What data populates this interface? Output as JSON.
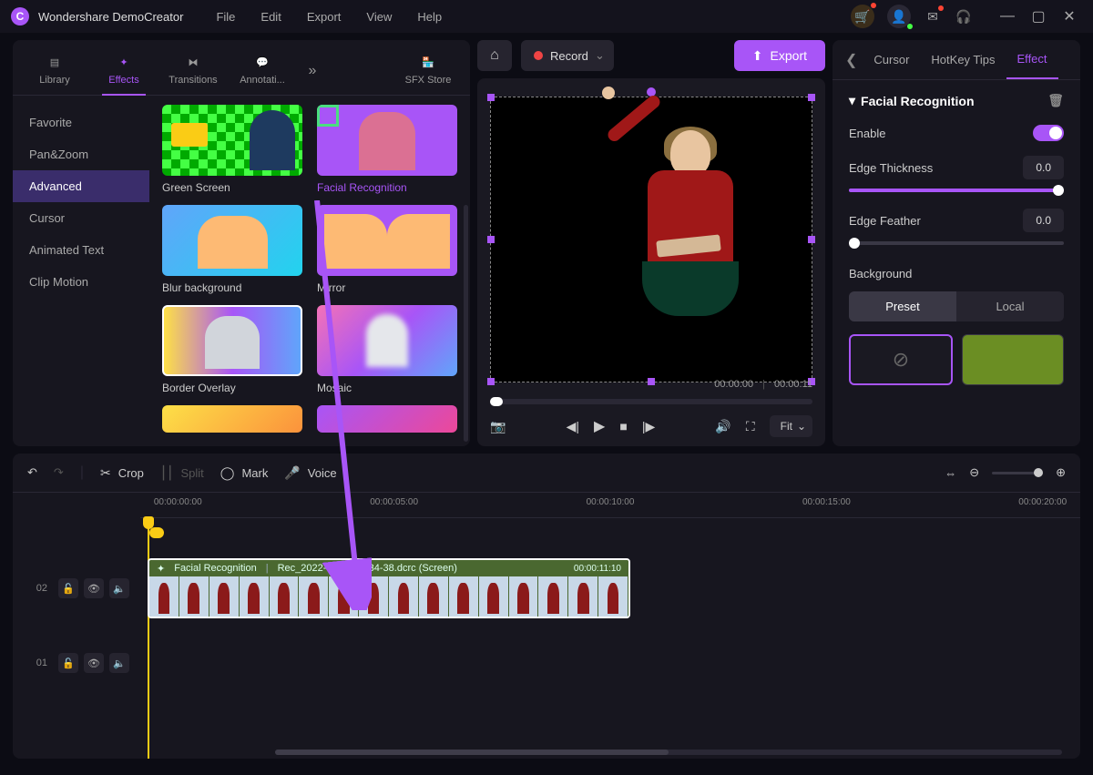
{
  "app": {
    "title": "Wondershare DemoCreator"
  },
  "menu": {
    "file": "File",
    "edit": "Edit",
    "export": "Export",
    "view": "View",
    "help": "Help"
  },
  "tabs": {
    "library": "Library",
    "effects": "Effects",
    "transitions": "Transitions",
    "annotations": "Annotati...",
    "sfx": "SFX Store"
  },
  "sidebar": {
    "favorite": "Favorite",
    "panzoom": "Pan&Zoom",
    "advanced": "Advanced",
    "cursor": "Cursor",
    "animated": "Animated Text",
    "clipmotion": "Clip Motion"
  },
  "effects": {
    "green": "Green Screen",
    "facial": "Facial Recognition",
    "blur": "Blur background",
    "mirror": "Mirror",
    "border": "Border Overlay",
    "mosaic": "Mosaic"
  },
  "center": {
    "record": "Record",
    "export": "Export",
    "time_current": "00:00:00",
    "time_total": "00:00:11",
    "fit": "Fit"
  },
  "rp": {
    "tabs": {
      "cursor": "Cursor",
      "hotkey": "HotKey Tips",
      "effect": "Effect"
    },
    "title": "Facial Recognition",
    "enable": "Enable",
    "thickness": "Edge Thickness",
    "thickness_val": "0.0",
    "feather": "Edge Feather",
    "feather_val": "0.0",
    "background": "Background",
    "preset": "Preset",
    "local": "Local"
  },
  "timeline": {
    "crop": "Crop",
    "split": "Split",
    "mark": "Mark",
    "voice": "Voice",
    "times": [
      "00:00:00:00",
      "00:00:05:00",
      "00:00:10:00",
      "00:00:15:00",
      "00:00:20:00"
    ],
    "clip_effect": "Facial Recognition",
    "clip_name": "Rec_2022-07-12 11-34-38.dcrc (Screen)",
    "clip_dur": "00:00:11:10",
    "tracks": {
      "t1": "01",
      "t2": "02"
    }
  }
}
